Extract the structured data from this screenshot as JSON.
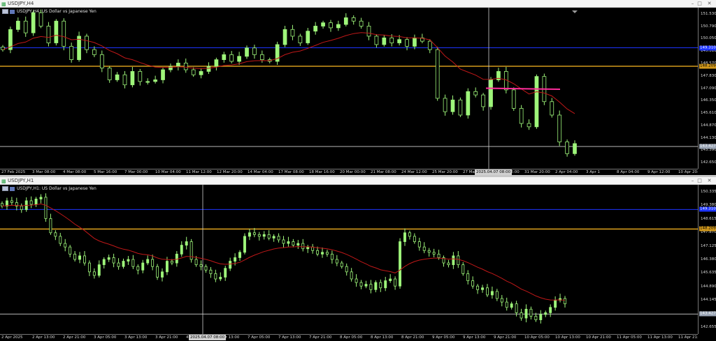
{
  "colors": {
    "bull": "#9ef57a",
    "ma": "#c01818",
    "blue_level": "#1c34ff",
    "gold_level": "#d39a1c",
    "white_level": "#cfcfcf",
    "trendline": "#ff2d9c",
    "crosshair": "#cfcfcf"
  },
  "top": {
    "window_title": "USDJPY,H4",
    "chart_label": "USDJPY,H4:  US Dollar vs Japanese Yen",
    "price_labels": [
      "151.530",
      "150.790",
      "150.050",
      "149.310",
      "148.570",
      "147.830",
      "147.090",
      "146.350",
      "145.610",
      "144.870",
      "144.130",
      "143.390",
      "142.650"
    ],
    "level_tags": [
      "149.310",
      "148.209",
      "143.427"
    ],
    "time_labels": [
      "27 Feb 2025",
      "3 Mar 08:00",
      "4 Mar 08:00",
      "5 Mar 16:00",
      "7 Mar 00:00",
      "10 Mar 04:00",
      "11 Mar 12:00",
      "12 Mar 20:00",
      "14 Mar 04:00",
      "17 Mar 08:00",
      "18 Mar 16:00",
      "20 Mar 00:00",
      "21 Mar 08:00",
      "24 Mar 12:00",
      "25 Mar 20:00",
      "27 Mar 04:00",
      "28 Mar 12:00",
      "31 Mar 20:00",
      "2 Apr 04:00",
      "3 Apr 1",
      "8 Apr 04:00",
      "9 Apr 12:00",
      "10 Apr 20:00"
    ],
    "cursor_time": "2025.04.07 08:00"
  },
  "bottom": {
    "window_title": "USDJPY,H1",
    "chart_label": "USDJPY,H1:  US Dollar vs Japanese Yen",
    "price_labels": [
      "150.335",
      "149.380",
      "148.615",
      "147.870",
      "147.125",
      "146.380",
      "145.635",
      "144.890",
      "144.145",
      "143.400",
      "142.655"
    ],
    "level_tags": [
      "149.310",
      "148.209",
      "143.427"
    ],
    "time_labels": [
      "2 Apr 2025",
      "2 Apr 13:00",
      "2 Apr 21:00",
      "3 Apr 05:00",
      "3 Apr 13:00",
      "3 Apr 21:00",
      "4 Apr 05:00",
      "4 Apr 13:00",
      "7 Apr 05:00",
      "7 Apr 13:00",
      "7 Apr 21:00",
      "8 Apr 05:00",
      "8 Apr 13:00",
      "8 Apr 21:00",
      "9 Apr 05:00",
      "9 Apr 13:00",
      "9 Apr 21:00",
      "10 Apr 05:00",
      "10 Apr 13:00",
      "10 Apr 21:00",
      "11 Apr 05:00",
      "11 Apr 13:00",
      "11 Apr 21:00"
    ],
    "cursor_time": "2025.04.07 08:00"
  },
  "chart_data": [
    {
      "type": "line",
      "title": "USDJPY,H4: US Dollar vs Japanese Yen",
      "ylim": [
        142.1,
        151.7
      ],
      "levels": {
        "blue": 149.31,
        "gold": 148.209,
        "white": 143.427,
        "trendline": 146.9
      },
      "series": [
        {
          "values": [
            149.2,
            150.4,
            150.9,
            150.2,
            151.4,
            150.6,
            149.6,
            150.9,
            149.4,
            148.6,
            150.0,
            149.2,
            148.9,
            148.1,
            147.4,
            147.7,
            147.1,
            147.9,
            147.3,
            147.3,
            147.4,
            148.0,
            148.2,
            148.4,
            148.0,
            147.7,
            147.9,
            148.2,
            148.6,
            148.9,
            148.5,
            148.8,
            149.3,
            148.9,
            148.6,
            148.5,
            149.5,
            150.4,
            150.0,
            149.6,
            150.3,
            150.6,
            150.8,
            150.5,
            150.7,
            151.1,
            150.9,
            150.6,
            150.0,
            149.5,
            149.9,
            149.6,
            149.8,
            149.4,
            149.9,
            149.7,
            149.2,
            146.3,
            145.5,
            146.2,
            145.3,
            146.7,
            146.5,
            145.8,
            147.4,
            147.9,
            146.8,
            145.7,
            144.8,
            144.6,
            147.6,
            146.1,
            145.3,
            143.7,
            143.0,
            143.6
          ]
        }
      ]
    },
    {
      "type": "line",
      "title": "USDJPY,H1: US Dollar vs Japanese Yen",
      "ylim": [
        142.3,
        150.7
      ],
      "levels": {
        "blue": 149.31,
        "gold": 148.209,
        "white": 143.427
      },
      "series": [
        {
          "values": [
            149.5,
            149.8,
            149.7,
            149.5,
            149.3,
            149.8,
            149.6,
            149.9,
            150.0,
            148.8,
            148.0,
            147.8,
            147.4,
            147.2,
            146.8,
            146.5,
            146.7,
            146.3,
            145.8,
            145.6,
            146.2,
            146.5,
            146.6,
            146.3,
            146.1,
            146.4,
            146.5,
            146.1,
            145.9,
            146.3,
            146.5,
            146.1,
            145.5,
            145.8,
            146.4,
            146.3,
            146.8,
            147.3,
            147.5,
            146.5,
            146.2,
            146.1,
            145.9,
            145.7,
            145.4,
            145.5,
            146.0,
            146.4,
            146.6,
            146.9,
            147.8,
            148.0,
            147.9,
            147.8,
            147.9,
            147.7,
            147.8,
            147.6,
            147.4,
            147.5,
            147.3,
            147.4,
            147.1,
            147.2,
            147.0,
            146.8,
            146.9,
            146.8,
            146.5,
            146.3,
            146.1,
            145.8,
            145.4,
            145.2,
            145.0,
            145.1,
            144.8,
            145.2,
            144.9,
            145.3,
            145.4,
            145.0,
            147.5,
            148.0,
            147.8,
            147.5,
            147.2,
            147.0,
            146.9,
            146.8,
            146.6,
            146.3,
            146.2,
            146.7,
            146.2,
            145.7,
            145.3,
            145.0,
            144.8,
            144.9,
            144.5,
            144.7,
            144.3,
            144.1,
            143.8,
            144.0,
            143.5,
            143.2,
            143.7,
            143.3,
            143.1,
            143.4,
            143.5,
            143.8,
            144.2,
            144.3,
            144.0
          ]
        }
      ]
    }
  ]
}
